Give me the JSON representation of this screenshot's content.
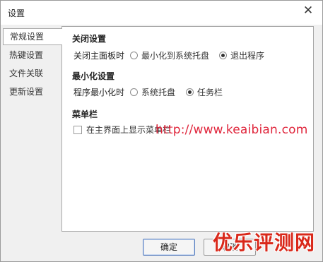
{
  "window": {
    "title": "设置"
  },
  "nav": {
    "items": [
      {
        "label": "常规设置",
        "active": true
      },
      {
        "label": "热键设置",
        "active": false
      },
      {
        "label": "文件关联",
        "active": false
      },
      {
        "label": "更新设置",
        "active": false
      }
    ]
  },
  "sections": {
    "close": {
      "title": "关闭设置",
      "row_label": "关闭主面板时",
      "options": [
        {
          "label": "最小化到系统托盘",
          "checked": false
        },
        {
          "label": "退出程序",
          "checked": true
        }
      ]
    },
    "minimize": {
      "title": "最小化设置",
      "row_label": "程序最小化时",
      "options": [
        {
          "label": "系统托盘",
          "checked": false
        },
        {
          "label": "任务栏",
          "checked": true
        }
      ]
    },
    "menubar": {
      "title": "菜单栏",
      "checkbox_label": "在主界面上显示菜单栏",
      "checked": false
    }
  },
  "watermark": {
    "text": "http://www.keaibian.com"
  },
  "buttons": {
    "ok": "确定",
    "cancel": "取消"
  },
  "brand": {
    "text": "优乐评测网"
  },
  "colors": {
    "watermark": "#e0263c",
    "brand": "#d9281a",
    "ok_border": "#5a7fbf"
  }
}
